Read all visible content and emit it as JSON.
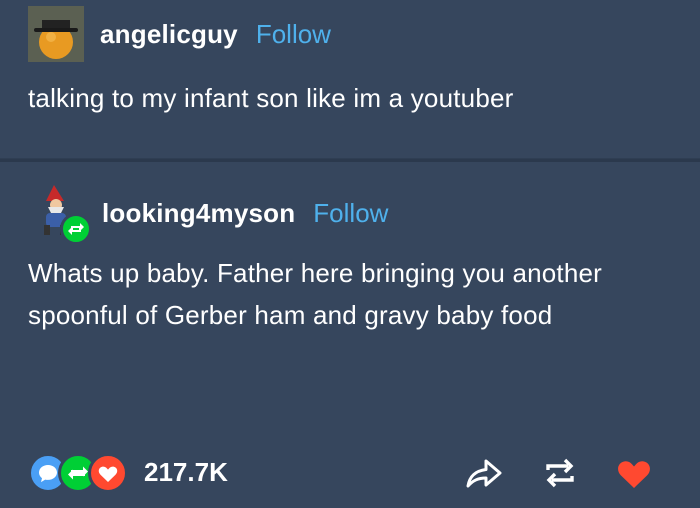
{
  "post_original": {
    "username": "angelicguy",
    "follow_label": "Follow",
    "text": "talking to my infant son like im a youtuber",
    "avatar_icon": "hat-orange-avatar"
  },
  "post_reblog": {
    "username": "looking4myson",
    "follow_label": "Follow",
    "text": "Whats up baby. Father here bringing you another spoonful of Gerber ham and gravy baby food",
    "avatar_icon": "gnome-avatar",
    "reblog_badge_icon": "reblog-badge-icon"
  },
  "footer": {
    "notes_count": "217.7K",
    "note_badges": [
      "reply-icon",
      "reblog-icon",
      "heart-icon"
    ],
    "actions": [
      "share-icon",
      "reblog-icon",
      "heart-icon"
    ]
  },
  "colors": {
    "background": "#36465d",
    "link": "#4fb1ec",
    "reply_badge": "#4a9ff5",
    "reblog_badge": "#00cf35",
    "like": "#ff4930"
  }
}
